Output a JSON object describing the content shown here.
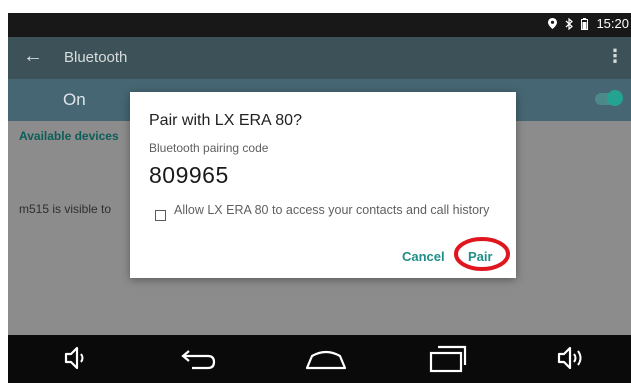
{
  "status_bar": {
    "time": "15:20"
  },
  "app_bar": {
    "back_icon": "←",
    "title": "Bluetooth",
    "overflow_icon": "⋮"
  },
  "toggle_row": {
    "label": "On",
    "enabled": true
  },
  "content": {
    "section_header": "Available devices",
    "visibility_text": "m515 is visible to"
  },
  "dialog": {
    "title": "Pair with LX ERA 80?",
    "code_label": "Bluetooth pairing code",
    "code": "809965",
    "checkbox_label": "Allow LX ERA 80 to access your contacts and call history",
    "checkbox_checked": false,
    "cancel_label": "Cancel",
    "pair_label": "Pair"
  },
  "colors": {
    "accent": "#1f8f87",
    "highlight_ring": "#e0161f",
    "app_bar": "#3d5258"
  },
  "nav_bar": {
    "icons": [
      "volume-down-icon",
      "back-icon",
      "home-icon",
      "recent-apps-icon",
      "volume-up-icon"
    ]
  }
}
